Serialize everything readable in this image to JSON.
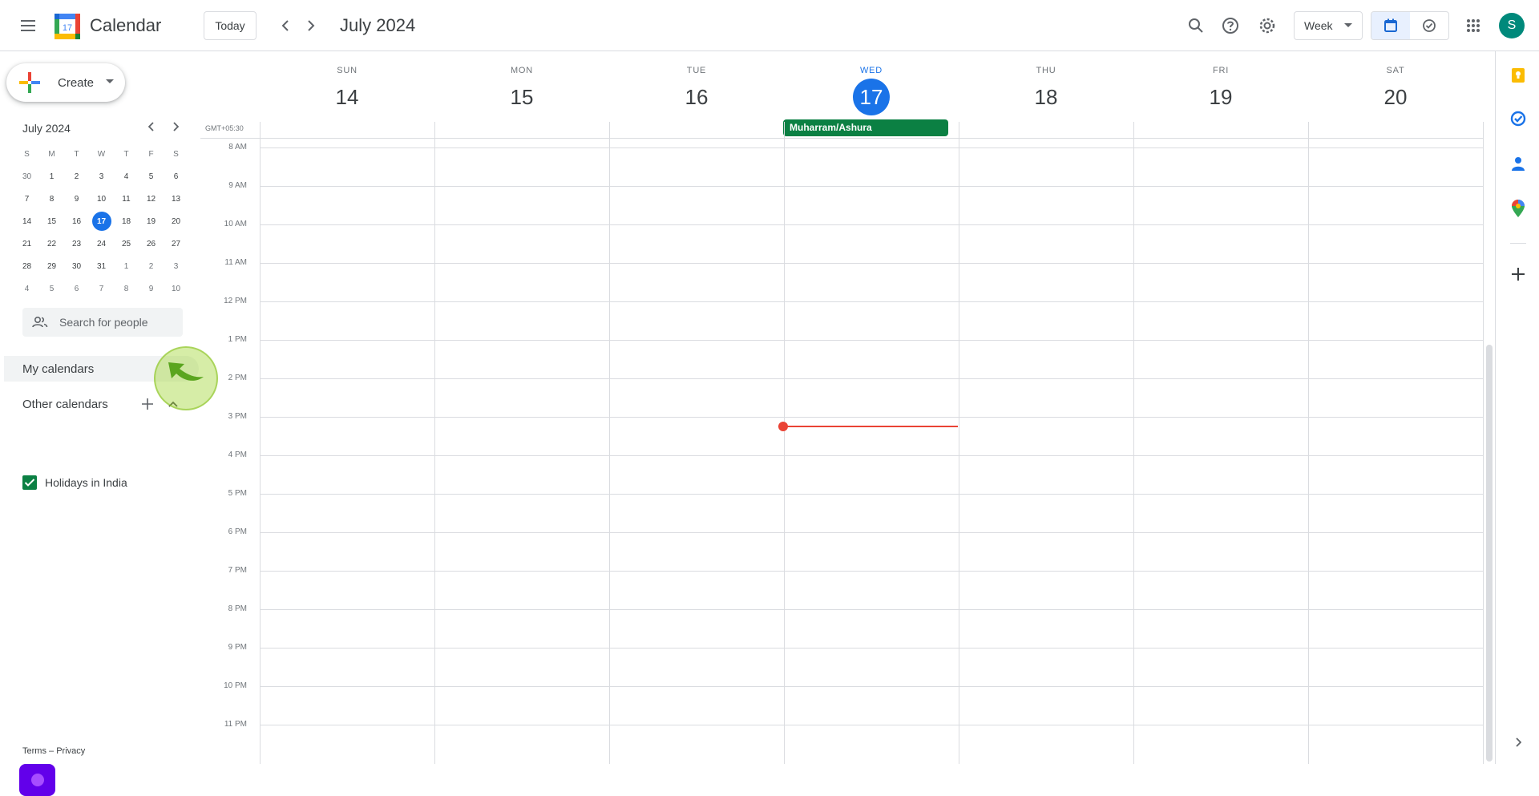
{
  "header": {
    "app_title": "Calendar",
    "logo_day": "17",
    "today_label": "Today",
    "period_title": "July 2024",
    "view_label": "Week",
    "avatar_initial": "S"
  },
  "sidebar": {
    "create_label": "Create",
    "mini_calendar": {
      "title": "July 2024",
      "weekday_headers": [
        "S",
        "M",
        "T",
        "W",
        "T",
        "F",
        "S"
      ],
      "weeks": [
        [
          "30",
          "1",
          "2",
          "3",
          "4",
          "5",
          "6"
        ],
        [
          "7",
          "8",
          "9",
          "10",
          "11",
          "12",
          "13"
        ],
        [
          "14",
          "15",
          "16",
          "17",
          "18",
          "19",
          "20"
        ],
        [
          "21",
          "22",
          "23",
          "24",
          "25",
          "26",
          "27"
        ],
        [
          "28",
          "29",
          "30",
          "31",
          "1",
          "2",
          "3"
        ],
        [
          "4",
          "5",
          "6",
          "7",
          "8",
          "9",
          "10"
        ]
      ],
      "today": "17"
    },
    "search_people_placeholder": "Search for people",
    "my_calendars_label": "My calendars",
    "other_calendars_label": "Other calendars",
    "calendars": [
      {
        "label": "Holidays in India",
        "checked": true,
        "color": "#0b8043"
      }
    ],
    "footer_terms": "Terms",
    "footer_sep": "–",
    "footer_privacy": "Privacy"
  },
  "grid": {
    "timezone": "GMT+05:30",
    "days": [
      {
        "dow": "SUN",
        "num": "14",
        "today": false
      },
      {
        "dow": "MON",
        "num": "15",
        "today": false
      },
      {
        "dow": "TUE",
        "num": "16",
        "today": false
      },
      {
        "dow": "WED",
        "num": "17",
        "today": true
      },
      {
        "dow": "THU",
        "num": "18",
        "today": false
      },
      {
        "dow": "FRI",
        "num": "19",
        "today": false
      },
      {
        "dow": "SAT",
        "num": "20",
        "today": false
      }
    ],
    "allday_event": {
      "title": "Muharram/Ashura",
      "day": "WED",
      "color": "#0b8043"
    },
    "hours": [
      "8 AM",
      "9 AM",
      "10 AM",
      "11 AM",
      "12 PM",
      "1 PM",
      "2 PM",
      "3 PM",
      "4 PM",
      "5 PM",
      "6 PM",
      "7 PM",
      "8 PM",
      "9 PM",
      "10 PM",
      "11 PM"
    ]
  },
  "colors": {
    "accent": "#1a73e8",
    "now_indicator": "#ea4335",
    "holiday": "#0b8043"
  }
}
